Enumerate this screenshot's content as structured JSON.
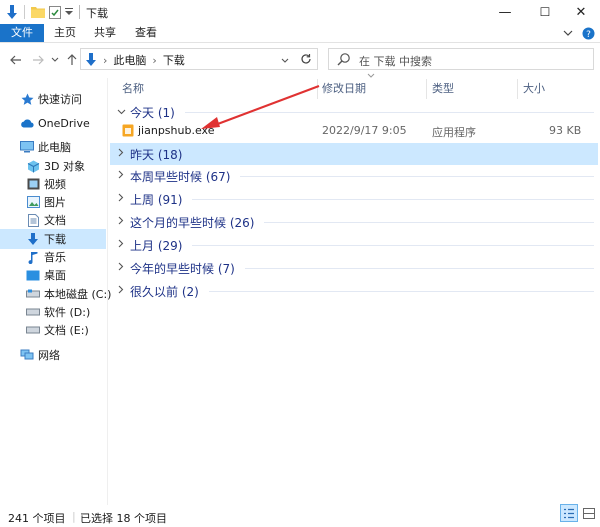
{
  "window": {
    "title": "下载",
    "controls": {
      "minimize": "—",
      "maximize": "☐",
      "close": "✕"
    }
  },
  "ribbon": {
    "tabs": [
      "文件",
      "主页",
      "共享",
      "查看"
    ],
    "expand_icon": "chevron-down",
    "help_icon": "?"
  },
  "address": {
    "path": [
      "此电脑",
      "下载"
    ],
    "separator": "›"
  },
  "search": {
    "placeholder": "在 下载 中搜索"
  },
  "nav": {
    "items": [
      {
        "label": "快速访问",
        "icon": "star-icon"
      },
      {
        "label": "OneDrive",
        "icon": "cloud-icon"
      },
      {
        "label": "此电脑",
        "icon": "pc-icon"
      },
      {
        "label": "3D 对象",
        "icon": "cube-icon"
      },
      {
        "label": "视频",
        "icon": "video-icon"
      },
      {
        "label": "图片",
        "icon": "picture-icon"
      },
      {
        "label": "文档",
        "icon": "document-icon"
      },
      {
        "label": "下载",
        "icon": "download-icon"
      },
      {
        "label": "音乐",
        "icon": "music-icon"
      },
      {
        "label": "桌面",
        "icon": "desktop-icon"
      },
      {
        "label": "本地磁盘 (C:)",
        "icon": "drive-icon"
      },
      {
        "label": "软件 (D:)",
        "icon": "drive-icon"
      },
      {
        "label": "文档 (E:)",
        "icon": "drive-icon"
      },
      {
        "label": "网络",
        "icon": "network-icon"
      }
    ]
  },
  "columns": {
    "name": "名称",
    "date": "修改日期",
    "type": "类型",
    "size": "大小"
  },
  "groups": [
    {
      "label": "今天 (1)",
      "expanded": true
    },
    {
      "label": "昨天 (18)",
      "expanded": false
    },
    {
      "label": "本周早些时候 (67)",
      "expanded": false
    },
    {
      "label": "上周 (91)",
      "expanded": false
    },
    {
      "label": "这个月的早些时候 (26)",
      "expanded": false
    },
    {
      "label": "上月 (29)",
      "expanded": false
    },
    {
      "label": "今年的早些时候 (7)",
      "expanded": false
    },
    {
      "label": "很久以前 (2)",
      "expanded": false
    }
  ],
  "file": {
    "name": "jianpshub.exe",
    "date": "2022/9/17 9:05",
    "type": "应用程序",
    "size": "93 KB"
  },
  "status": {
    "count": "241 个项目",
    "selection": "已选择 18 个项目"
  },
  "colors": {
    "accent": "#1a73c9",
    "selection": "#cce8ff",
    "group_text": "#1e3287",
    "arrow": "#e03232"
  }
}
